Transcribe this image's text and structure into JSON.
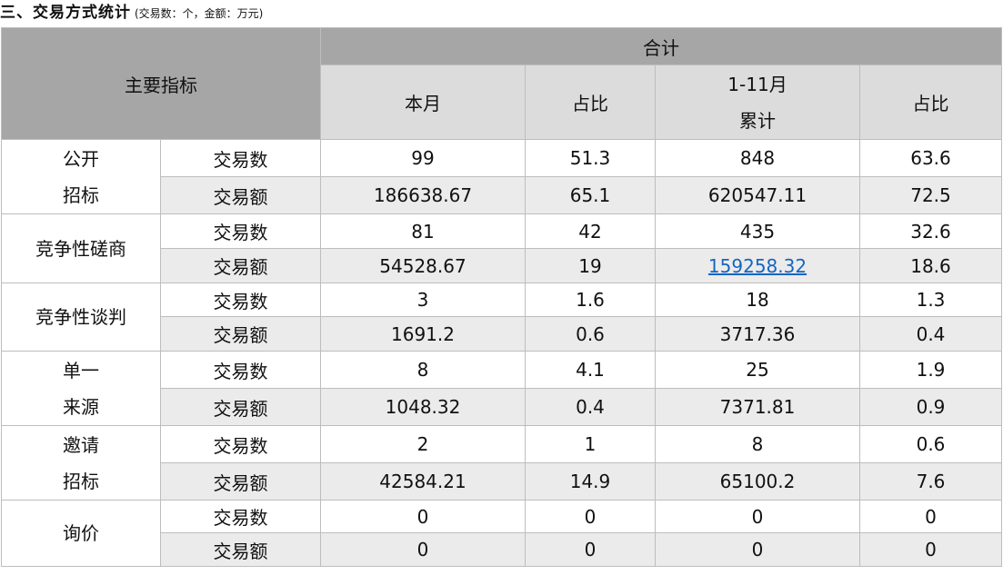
{
  "title": "三、交易方式统计",
  "subtitle": "(交易数：个，金额：万元)",
  "header": {
    "main_indicator": "主要指标",
    "total": "合计",
    "this_month": "本月",
    "share": "占比",
    "cumulative_line1": "1-11月",
    "cumulative_line2": "累计",
    "share2": "占比"
  },
  "groups": [
    {
      "name_lines": [
        "公开",
        "招标"
      ],
      "rows": [
        {
          "metric": "交易数",
          "month": "99",
          "month_share": "51.3",
          "cum": "848",
          "cum_share": "63.6"
        },
        {
          "metric": "交易额",
          "month": "186638.67",
          "month_share": "65.1",
          "cum": "620547.11",
          "cum_share": "72.5"
        }
      ]
    },
    {
      "name_lines": [
        "竞争性磋商"
      ],
      "rows": [
        {
          "metric": "交易数",
          "month": "81",
          "month_share": "42",
          "cum": "435",
          "cum_share": "32.6"
        },
        {
          "metric": "交易额",
          "month": "54528.67",
          "month_share": "19",
          "cum": "159258.32",
          "cum_share": "18.6"
        }
      ]
    },
    {
      "name_lines": [
        "竞争性谈判"
      ],
      "rows": [
        {
          "metric": "交易数",
          "month": "3",
          "month_share": "1.6",
          "cum": "18",
          "cum_share": "1.3"
        },
        {
          "metric": "交易额",
          "month": "1691.2",
          "month_share": "0.6",
          "cum": "3717.36",
          "cum_share": "0.4"
        }
      ]
    },
    {
      "name_lines": [
        "单一",
        "来源"
      ],
      "rows": [
        {
          "metric": "交易数",
          "month": "8",
          "month_share": "4.1",
          "cum": "25",
          "cum_share": "1.9"
        },
        {
          "metric": "交易额",
          "month": "1048.32",
          "month_share": "0.4",
          "cum": "7371.81",
          "cum_share": "0.9"
        }
      ]
    },
    {
      "name_lines": [
        "邀请",
        "招标"
      ],
      "rows": [
        {
          "metric": "交易数",
          "month": "2",
          "month_share": "1",
          "cum": "8",
          "cum_share": "0.6"
        },
        {
          "metric": "交易额",
          "month": "42584.21",
          "month_share": "14.9",
          "cum": "65100.2",
          "cum_share": "7.6"
        }
      ]
    },
    {
      "name_lines": [
        "询价"
      ],
      "rows": [
        {
          "metric": "交易数",
          "month": "0",
          "month_share": "0",
          "cum": "0",
          "cum_share": "0"
        },
        {
          "metric": "交易额",
          "month": "0",
          "month_share": "0",
          "cum": "0",
          "cum_share": "0"
        }
      ]
    }
  ]
}
